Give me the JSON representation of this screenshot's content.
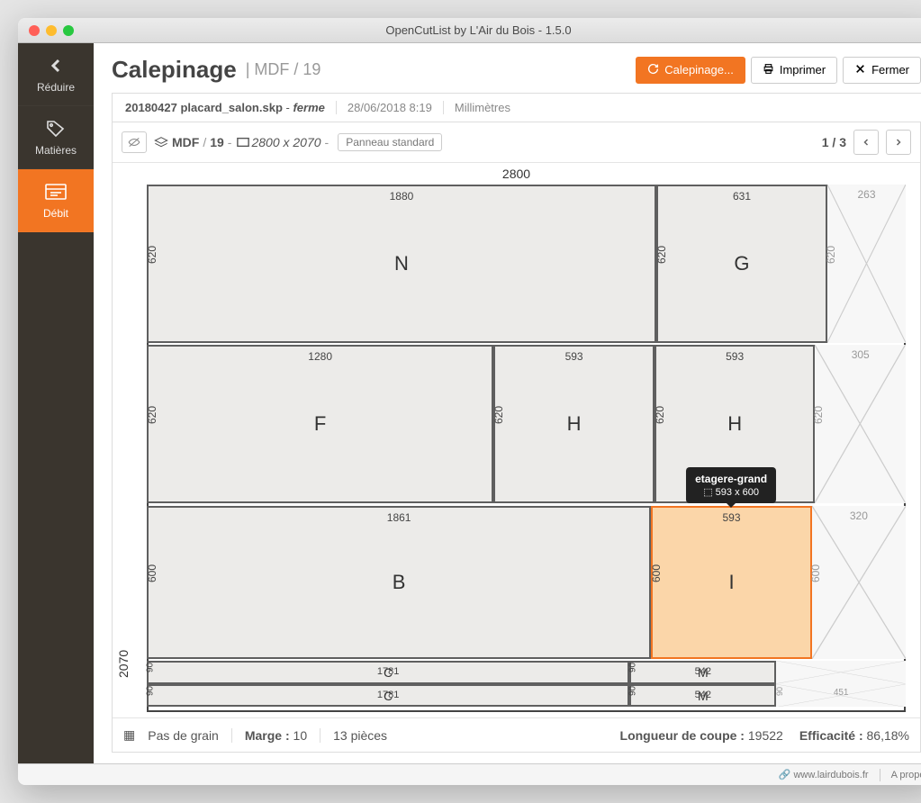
{
  "window_title": "OpenCutList by L'Air du Bois - 1.5.0",
  "sidebar": {
    "reduce": "Réduire",
    "materials": "Matières",
    "debit": "Débit"
  },
  "header": {
    "title": "Calepinage",
    "subtitle": "| MDF / 19",
    "buttons": {
      "calepinage": "Calepinage...",
      "print": "Imprimer",
      "close": "Fermer"
    }
  },
  "file_tab": {
    "filename": "20180427 placard_salon.skp",
    "state": "ferme",
    "datetime": "28/06/2018 8:19",
    "unit": "Millimètres"
  },
  "panel": {
    "material": "MDF",
    "thickness": "19",
    "dimensions": "2800 x 2070",
    "std_label": "Panneau standard",
    "pager": "1 / 3",
    "axis_w": "2800",
    "axis_h": "2070"
  },
  "pieces": {
    "N": {
      "w": "1880",
      "h": "620",
      "letter": "N"
    },
    "G": {
      "w": "631",
      "h": "620",
      "letter": "G"
    },
    "F": {
      "w": "1280",
      "h": "620",
      "letter": "F"
    },
    "H1": {
      "w": "593",
      "h": "620",
      "letter": "H"
    },
    "H2": {
      "w": "593",
      "h": "620",
      "letter": "H"
    },
    "B": {
      "w": "1861",
      "h": "600",
      "letter": "B"
    },
    "I": {
      "w": "593",
      "h": "600",
      "letter": "I"
    },
    "C1": {
      "w": "1781",
      "h": "90",
      "letter": "C"
    },
    "C2": {
      "w": "1781",
      "h": "90",
      "letter": "C"
    },
    "M1": {
      "w": "542",
      "h": "90",
      "letter": "M"
    },
    "M2": {
      "w": "542",
      "h": "90",
      "letter": "M"
    }
  },
  "wastes": {
    "w1": {
      "w": "263",
      "h": "620"
    },
    "w2": {
      "w": "305",
      "h": "620"
    },
    "w3": {
      "w": "320",
      "h": "600"
    },
    "w4": {
      "w": "451",
      "h": "90"
    }
  },
  "tooltip": {
    "title": "etagere-grand",
    "dims": "593 x 600"
  },
  "footer": {
    "grain": "Pas de grain",
    "margin_label": "Marge :",
    "margin_value": "10",
    "pieces_label": "13 pièces",
    "cut_label": "Longueur de coupe :",
    "cut_value": "19522",
    "eff_label": "Efficacité :",
    "eff_value": "86,18%"
  },
  "status": {
    "url": "www.lairdubois.fr",
    "about": "A propos"
  }
}
